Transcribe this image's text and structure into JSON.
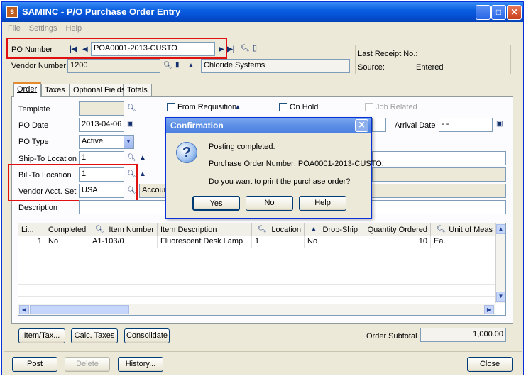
{
  "window": {
    "title": "SAMINC - P/O Purchase Order Entry",
    "app_icon": "sage-app-icon"
  },
  "menu": [
    "File",
    "Settings",
    "Help"
  ],
  "header": {
    "po_number_label": "PO Number",
    "po_number_value": "POA0001-2013-CUSTO",
    "vendor_label": "Vendor Number",
    "vendor_value": "1200",
    "vendor_name": "Chloride Systems",
    "last_receipt_label": "Last Receipt No.:",
    "last_receipt_value": "",
    "source_label": "Source:",
    "source_value": "Entered"
  },
  "tabs": [
    "Order",
    "Taxes",
    "Optional Fields",
    "Totals"
  ],
  "order": {
    "template_label": "Template",
    "template_value": "",
    "from_requisition_label": "From Requisition",
    "on_hold_label": "On Hold",
    "job_related_label": "Job Related",
    "po_date_label": "PO Date",
    "po_date_value": "2013-04-06",
    "arrival_date_label": "Arrival Date",
    "arrival_date_value": " - - ",
    "po_type_label": "PO Type",
    "po_type_value": "Active",
    "ship_to_label": "Ship-To Location",
    "ship_to_value": "1",
    "bill_to_label": "Bill-To Location",
    "bill_to_value": "1",
    "vendor_acct_label": "Vendor Acct. Set",
    "vendor_acct_value": "USA",
    "vendor_acct_desc": "Accoun",
    "description_label": "Description",
    "description_value": ""
  },
  "grid": {
    "columns": [
      "Li...",
      "Completed",
      "Item Number",
      "Item Description",
      "Location",
      "Drop-Ship",
      "Quantity Ordered",
      "Unit of Meas"
    ],
    "rows": [
      {
        "line": "1",
        "completed": "No",
        "item": "A1-103/0",
        "desc": "Fluorescent Desk Lamp",
        "location": "1",
        "dropship": "No",
        "qty": "10",
        "uom": "Ea."
      }
    ]
  },
  "bottom": {
    "item_tax": "Item/Tax...",
    "calc_taxes": "Calc. Taxes",
    "consolidate": "Consolidate",
    "order_subtotal_label": "Order Subtotal",
    "order_subtotal_value": "1,000.00"
  },
  "footer": {
    "post": "Post",
    "delete": "Delete",
    "history": "History...",
    "close": "Close"
  },
  "dialog": {
    "title": "Confirmation",
    "line1": "Posting completed.",
    "line2": "Purchase Order Number: POA0001-2013-CUSTO.",
    "line3": "Do you want to print the purchase order?",
    "yes": "Yes",
    "no": "No",
    "help": "Help"
  },
  "colors": {
    "highlight_box": "#e01010",
    "titlebar": "#0a5fe0"
  }
}
